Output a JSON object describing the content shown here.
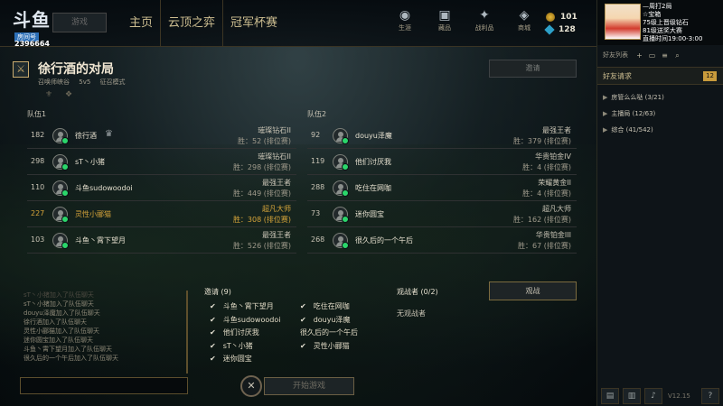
{
  "stream": {
    "logo": "斗鱼",
    "badge": "房间号",
    "room_id": "2396664"
  },
  "topbar": {
    "play_label": "游戏",
    "nav": [
      "主页",
      "云顶之弈",
      "冠军杯赛"
    ],
    "icons": [
      {
        "label": "生涯",
        "icon": "profile-icon"
      },
      {
        "label": "藏品",
        "icon": "collection-icon"
      },
      {
        "label": "战利品",
        "icon": "loot-icon"
      },
      {
        "label": "商城",
        "icon": "store-icon"
      }
    ],
    "rp": "101",
    "be": "128"
  },
  "sidebar": {
    "mini_lines": [
      "—周打2局",
      "☆宝箱",
      "75级上晋级钻石",
      "81级送奖大赛",
      "直播时间19:00-3:00"
    ],
    "friends_label": "好友列表",
    "friend_requests_label": "好友请求",
    "friend_requests_count": "12",
    "groups": [
      {
        "label": "房管么么哒 (3/21)"
      },
      {
        "label": "主播局 (12/63)"
      },
      {
        "label": "综合 (41/542)"
      }
    ],
    "version": "V12.15"
  },
  "lobby": {
    "title": "徐行酒的对局",
    "sub": [
      "召唤师峡谷",
      "5v5",
      "征召模式"
    ],
    "invite_label": "邀请"
  },
  "team1": {
    "title": "队伍1",
    "players": [
      {
        "level": "182",
        "name": "徐行酒",
        "rank": "璀璨钻石II",
        "wins": "胜：52  (排位赛)"
      },
      {
        "level": "298",
        "name": "sT丶小猪",
        "rank": "璀璨钻石II",
        "wins": "胜：298  (排位赛)"
      },
      {
        "level": "110",
        "name": "斗鱼sudowoodoi",
        "rank": "最强王者",
        "wins": "胜：449  (排位赛)"
      },
      {
        "level": "227",
        "name": "灵性小郦猫",
        "rank": "超凡大师",
        "wins": "胜：308  (排位赛)"
      },
      {
        "level": "103",
        "name": "斗鱼丶霄下望月",
        "rank": "最强王者",
        "wins": "胜：526  (排位赛)"
      }
    ]
  },
  "team2": {
    "title": "队伍2",
    "players": [
      {
        "level": "92",
        "name": "douyu泽魔",
        "rank": "最强王者",
        "wins": "胜：379  (排位赛)"
      },
      {
        "level": "119",
        "name": "他们讨厌我",
        "rank": "华贵铂金IV",
        "wins": "胜：4  (排位赛)"
      },
      {
        "level": "288",
        "name": "吃住在网咖",
        "rank": "荣耀黄金II",
        "wins": "胜：4  (排位赛)"
      },
      {
        "level": "73",
        "name": "迷你圆宝",
        "rank": "超凡大师",
        "wins": "胜：162  (排位赛)"
      },
      {
        "level": "268",
        "name": "很久后的一个午后",
        "rank": "华贵铂金III",
        "wins": "胜：67  (排位赛)"
      }
    ]
  },
  "chat": {
    "lines": [
      "sT丶小猪加入了队伍聊天",
      "sT丶小猪加入了队伍聊天",
      "douyu泽魔加入了队伍聊天",
      "徐行酒加入了队伍聊天",
      "灵性小郦猫加入了队伍聊天",
      "迷你圆宝加入了队伍聊天",
      "斗鱼丶霄下望月加入了队伍聊天",
      "很久后的一个午后加入了队伍聊天"
    ]
  },
  "invites": {
    "title": "邀请 (9)",
    "col1": [
      {
        "name": "斗鱼丶霄下望月",
        "checked": true
      },
      {
        "name": "斗鱼sudowoodoi",
        "checked": true
      },
      {
        "name": "他们讨厌我",
        "checked": true
      },
      {
        "name": "sT丶小猪",
        "checked": true
      },
      {
        "name": "迷你圆宝",
        "checked": true
      }
    ],
    "col2": [
      {
        "name": "吃住在网咖",
        "checked": true
      },
      {
        "name": "douyu泽魔",
        "checked": true
      },
      {
        "name": "很久后的一个午后",
        "checked": false
      },
      {
        "name": "灵性小郦猫",
        "checked": true
      }
    ]
  },
  "spectators": {
    "title": "观战者 (0/2)",
    "none": "无观战者",
    "watch_label": "观战"
  },
  "start": {
    "label": "开始游戏",
    "close": "✕"
  }
}
